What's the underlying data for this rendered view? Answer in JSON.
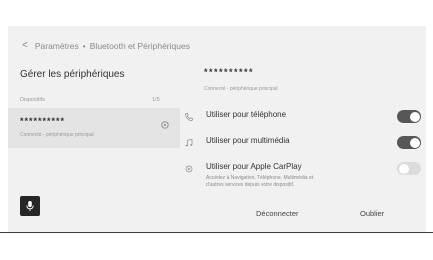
{
  "breadcrumb": {
    "back_symbol": "<",
    "parent": "Paramètres",
    "separator": "•",
    "current": "Bluetooth et Périphériques"
  },
  "page_title": "Gérer les périphériques",
  "devices_section": {
    "label": "Dispositifs",
    "count": "1/5"
  },
  "device": {
    "name": "**********",
    "status": "Connecté - périphérique principal"
  },
  "detail": {
    "name": "**********",
    "status": "Connecté - périphérique principal",
    "options": [
      {
        "icon": "phone-icon",
        "label": "Utiliser pour téléphone",
        "enabled": true
      },
      {
        "icon": "music-note-icon",
        "label": "Utiliser pour multimédia",
        "enabled": true
      },
      {
        "icon": "carplay-icon",
        "label": "Utiliser pour Apple CarPlay",
        "description": "Accédez à Navigation, Téléphone, Multimédia et d'autres services depuis votre dispositif.",
        "enabled": false
      }
    ],
    "actions": {
      "disconnect": "Déconnecter",
      "forget": "Oublier"
    }
  },
  "colors": {
    "toggle_on": "#575757",
    "toggle_off": "#dcdcdc",
    "background": "#f1f1f1",
    "selected_card": "#e4e4e4"
  }
}
